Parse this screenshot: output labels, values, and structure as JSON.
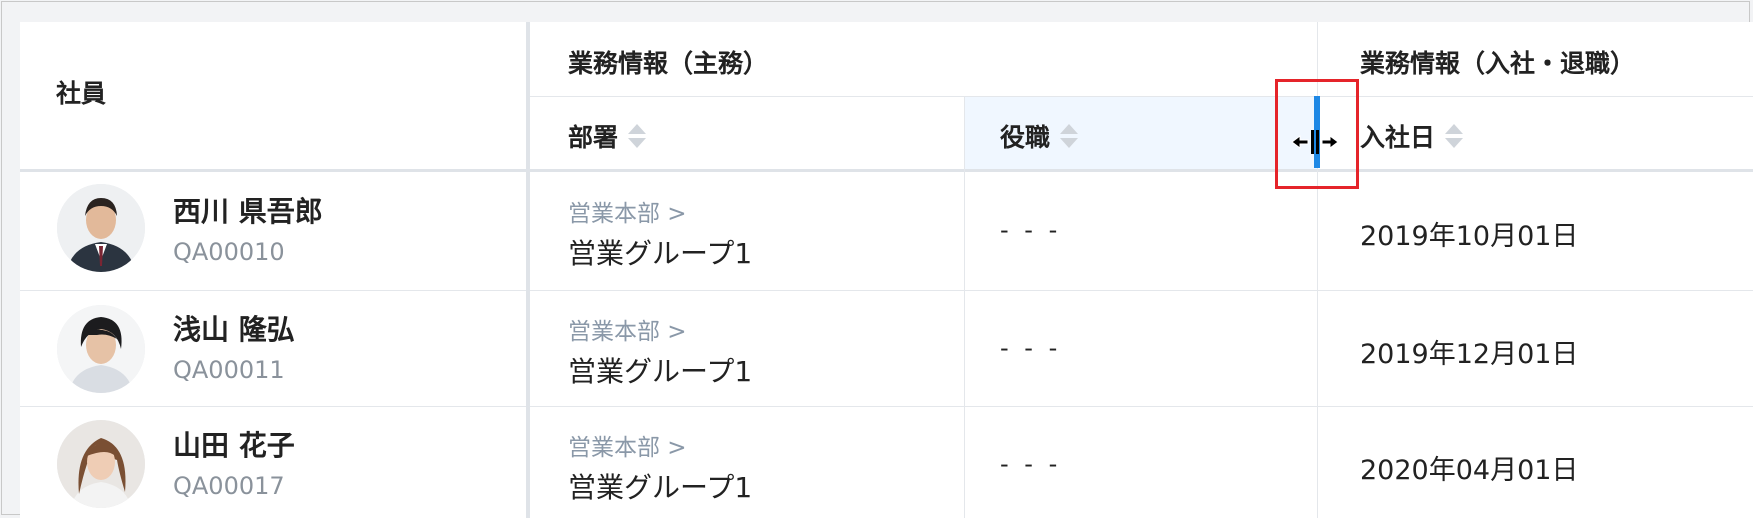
{
  "header": {
    "employee_label": "社員",
    "group_main_label": "業務情報（主務）",
    "group_join_label": "業務情報（入社・退職）",
    "dept_label": "部署",
    "position_label": "役職",
    "join_date_label": "入社日"
  },
  "rows": [
    {
      "name": "西川 県吾郎",
      "code": "QA00010",
      "dept_parent": "営業本部 >",
      "dept_name": "営業グループ1",
      "position": "- - -",
      "join_date": "2019年10月01日"
    },
    {
      "name": "浅山 隆弘",
      "code": "QA00011",
      "dept_parent": "営業本部 >",
      "dept_name": "営業グループ1",
      "position": "- - -",
      "join_date": "2019年12月01日"
    },
    {
      "name": "山田 花子",
      "code": "QA00017",
      "dept_parent": "営業本部 >",
      "dept_name": "営業グループ1",
      "position": "- - -",
      "join_date": "2020年04月01日"
    }
  ],
  "colors": {
    "position_header_bg": "#f0f7ff",
    "resize_bar": "#1e88e5",
    "highlight_box": "#e5242a"
  },
  "icons": [
    "sort-icon",
    "column-resize-cursor-icon"
  ]
}
